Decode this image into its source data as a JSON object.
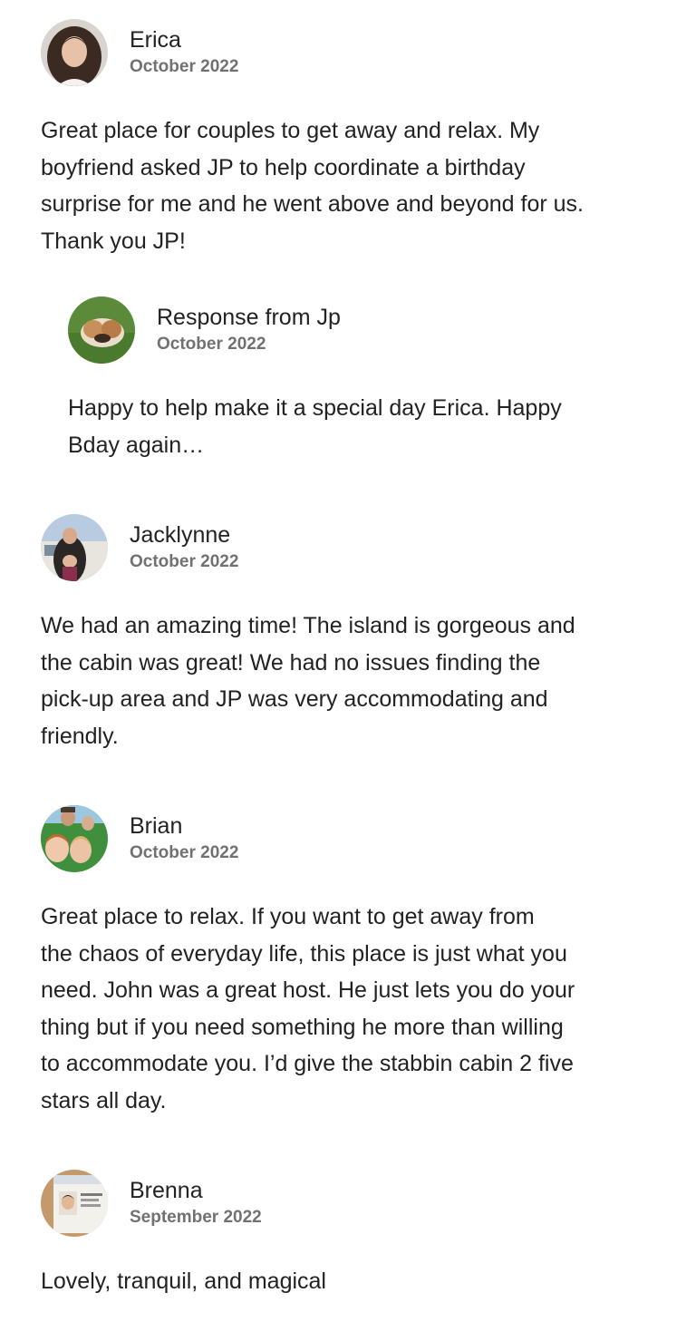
{
  "reviews": [
    {
      "name": "Erica",
      "date": "October 2022",
      "text": "Great place for couples to get away and relax. My\nboyfriend asked JP to help coordinate a birthday\nsurprise for me and he went above and beyond for us.\nThank you JP!",
      "response": {
        "title": "Response from Jp",
        "date": "October 2022",
        "text": "Happy to help make it a special day Erica. Happy\nBday again…"
      }
    },
    {
      "name": "Jacklynne",
      "date": "October 2022",
      "text": "We had an amazing time! The island is gorgeous and\nthe cabin was great! We had no issues finding the\npick-up area and JP was very accommodating and\nfriendly."
    },
    {
      "name": "Brian",
      "date": "October 2022",
      "text": "Great place to relax. If you want to get away from\nthe chaos of everyday life, this place is just what you\nneed. John was a great host. He just lets you do your\nthing but if you need something he more than willing\nto accommodate you. I’d give the stabbin cabin 2 five\nstars all day."
    },
    {
      "name": "Brenna",
      "date": "September 2022",
      "text": "Lovely, tranquil, and magical"
    }
  ]
}
